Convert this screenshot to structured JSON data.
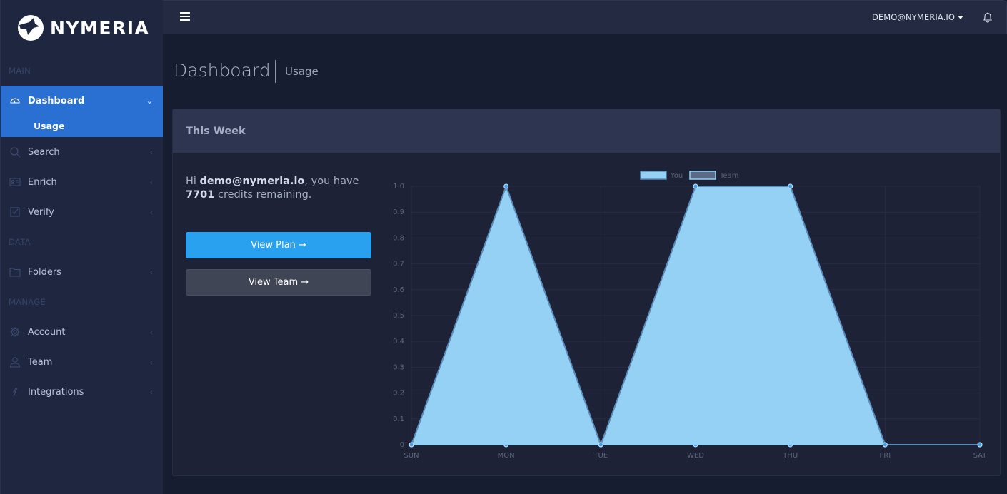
{
  "brand": {
    "name": "NYMERIA"
  },
  "topbar": {
    "user_email": "DEMO@NYMERIA.IO",
    "menu_icon": "hamburger-icon",
    "notification_icon": "bell-icon"
  },
  "sidebar": {
    "sections": {
      "main": "MAIN",
      "data": "DATA",
      "manage": "MANAGE"
    },
    "items": [
      {
        "label": "Dashboard",
        "icon": "gauge-icon",
        "active": true
      },
      {
        "label": "Search",
        "icon": "search-icon"
      },
      {
        "label": "Enrich",
        "icon": "id-card-icon"
      },
      {
        "label": "Verify",
        "icon": "checkbox-icon"
      },
      {
        "label": "Folders",
        "icon": "folder-icon"
      },
      {
        "label": "Account",
        "icon": "gear-icon"
      },
      {
        "label": "Team",
        "icon": "user-icon"
      },
      {
        "label": "Integrations",
        "icon": "plug-icon"
      }
    ],
    "dashboard_sub": [
      {
        "label": "Usage",
        "active": true
      }
    ]
  },
  "page": {
    "title": "Dashboard",
    "subtitle": "Usage"
  },
  "card": {
    "title": "This Week",
    "greeting": {
      "prefix": "Hi ",
      "email": "demo@nymeria.io",
      "middle": ", you have",
      "credits": "7701",
      "suffix": " credits remaining."
    },
    "buttons": {
      "view_plan": "View Plan →",
      "view_team": "View Team →"
    }
  },
  "chart_data": {
    "type": "area",
    "title": "",
    "xlabel": "",
    "ylabel": "",
    "categories": [
      "SUN",
      "MON",
      "TUE",
      "WED",
      "THU",
      "FRI",
      "SAT"
    ],
    "y_ticks": [
      "0",
      "0.1",
      "0.2",
      "0.3",
      "0.4",
      "0.5",
      "0.6",
      "0.7",
      "0.8",
      "0.9",
      "1.0"
    ],
    "ylim": [
      0,
      1.0
    ],
    "grid": true,
    "legend_position": "top-center",
    "series": [
      {
        "name": "You",
        "values": [
          0,
          1,
          0,
          1,
          1,
          0,
          0
        ],
        "fill": "#95d0f5",
        "stroke": "#5a8ab8"
      },
      {
        "name": "Team",
        "values": [
          0,
          0,
          0,
          0,
          0,
          0,
          0
        ],
        "fill": "#5a6b88",
        "stroke": "#95d0f5"
      }
    ]
  }
}
